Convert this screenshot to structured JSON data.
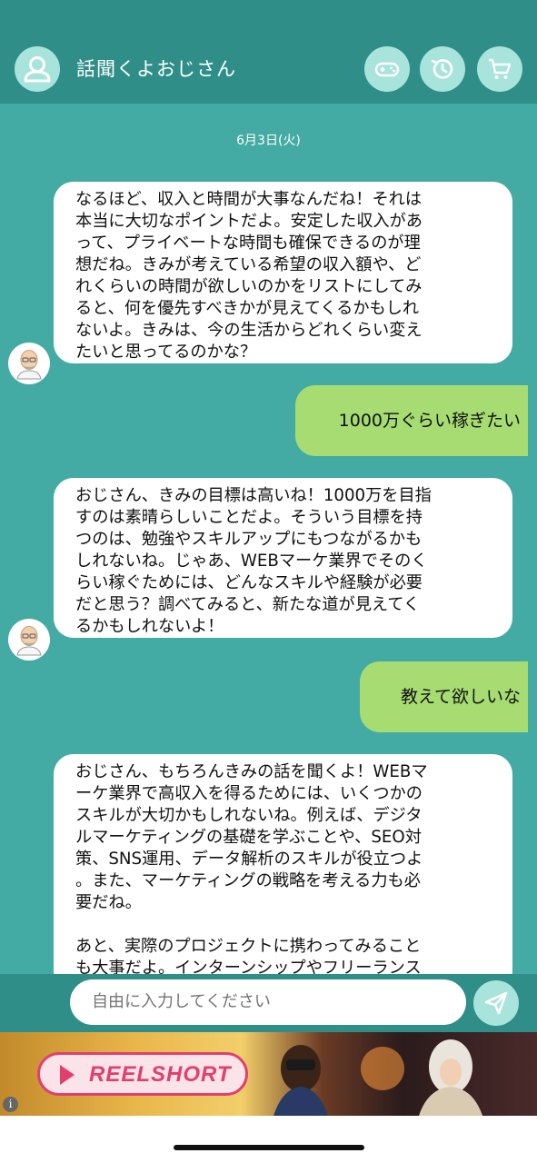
{
  "header": {
    "title": "話聞くよおじさん",
    "icons": [
      "user-icon",
      "gamepad-icon",
      "history-icon",
      "cart-icon"
    ]
  },
  "chat": {
    "date": "6月3日(火)",
    "messages": [
      {
        "from": "bot",
        "lines": [
          "なるほど、収入と時間が大事なんだね！それは",
          "本当に大切なポイントだよ。安定した収入があ",
          "って、プライベートな時間も確保できるのが理",
          "想だね。きみが考えている希望の収入額や、ど",
          "れくらいの時間が欲しいのかをリストにしてみ",
          "ると、何を優先すべきかが見えてくるかもしれ",
          "ないよ。きみは、今の生活からどれくらい変え",
          "たいと思ってるのかな？"
        ]
      },
      {
        "from": "user",
        "text": "1000万ぐらい稼ぎたい"
      },
      {
        "from": "bot",
        "lines": [
          "おじさん、きみの目標は高いね！1000万を目指",
          "すのは素晴らしいことだよ。そういう目標を持",
          "つのは、勉強やスキルアップにもつながるかも",
          "しれないね。じゃあ、WEBマーケ業界でそのく",
          "らい稼ぐためには、どんなスキルや経験が必要",
          "だと思う？調べてみると、新たな道が見えてく",
          "るかもしれないよ！"
        ]
      },
      {
        "from": "user",
        "text": "教えて欲しいな"
      },
      {
        "from": "bot",
        "lines": [
          "おじさん、もちろんきみの話を聞くよ！WEBマ",
          "ーケ業界で高収入を得るためには、いくつかの",
          "スキルが大切かもしれないね。例えば、デジタ",
          "ルマーケティングの基礎を学ぶことや、SEO対",
          "策、SNS運用、データ解析のスキルが役立つよ",
          "。また、マーケティングの戦略を考える力も必",
          "要だね。",
          "",
          "あと、実際のプロジェクトに携わってみること",
          "も大事だよ。インターンシップやフリーランス"
        ]
      }
    ]
  },
  "composer": {
    "placeholder": "自由に入力してください",
    "send_icon": "send-icon"
  },
  "ad": {
    "brand": "REELSHORT",
    "info_icon": "info-icon",
    "brand_color": "#e23f6e"
  },
  "colors": {
    "header": "#2f8f88",
    "chat_bg": "#43aba4",
    "user_bubble": "#a7dc72",
    "icon_circle": "#a8e3dc"
  }
}
